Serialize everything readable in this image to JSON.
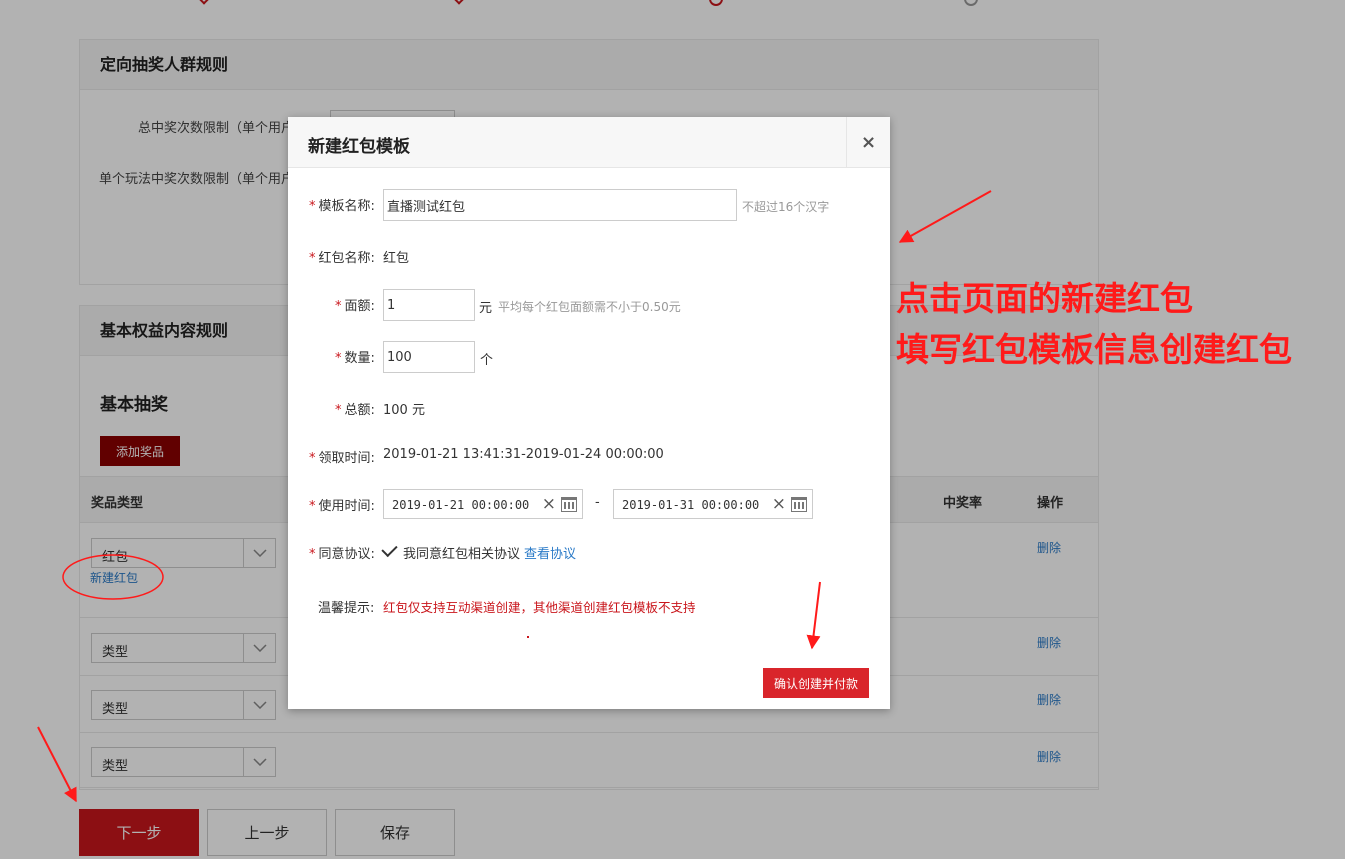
{
  "background": {
    "crowd_rules": {
      "title": "定向抽奖人群规则",
      "total_limit_label": "总中奖次数限制（单个用户",
      "single_limit_label": "单个玩法中奖次数限制（单个用户"
    },
    "basic_rules": {
      "title": "基本权益内容规则",
      "subtitle": "基本抽奖",
      "add_prize_label": "添加奖品",
      "columns": {
        "type": "奖品类型",
        "rate": "中奖率",
        "action": "操作"
      },
      "rows": [
        {
          "select_value": "红包",
          "link": "新建红包",
          "action": "删除"
        },
        {
          "select_value": "类型",
          "action": "删除"
        },
        {
          "select_value": "类型",
          "action": "删除"
        },
        {
          "select_value": "类型",
          "action": "删除"
        }
      ]
    },
    "footer": {
      "next_label": "下一步",
      "prev_label": "上一步",
      "save_label": "保存"
    }
  },
  "modal": {
    "title": "新建红包模板",
    "close_icon": "close-icon",
    "template_name": {
      "label": "模板名称:",
      "value": "直播测试红包",
      "hint": "不超过16个汉字"
    },
    "packet_name": {
      "label": "红包名称:",
      "value": "红包"
    },
    "denomination": {
      "label": "面额:",
      "value": "1",
      "unit": "元",
      "hint": "平均每个红包面额需不小于0.50元"
    },
    "quantity": {
      "label": "数量:",
      "value": "100",
      "unit": "个"
    },
    "total": {
      "label": "总额:",
      "value": "100 元"
    },
    "claim_time": {
      "label": "领取时间:",
      "value": "2019-01-21 13:41:31-2019-01-24 00:00:00"
    },
    "use_time": {
      "label": "使用时间:",
      "start": "2019-01-21 00:00:00",
      "separator": "-",
      "end": "2019-01-31 00:00:00"
    },
    "agreement": {
      "label": "同意协议:",
      "text": "我同意红包相关协议",
      "link": "查看协议",
      "checked": true
    },
    "notice": {
      "label": "温馨提示:",
      "text": "红包仅支持互动渠道创建，其他渠道创建红包模板不支持"
    },
    "confirm_label": "确认创建并付款"
  },
  "annotation": {
    "line1": "点击页面的新建红包",
    "line2": "填写红包模板信息创建红包"
  },
  "colors": {
    "primary_red": "#c9161c",
    "annotation_red": "#ff1a1a",
    "link_blue": "#2a7ac7"
  }
}
